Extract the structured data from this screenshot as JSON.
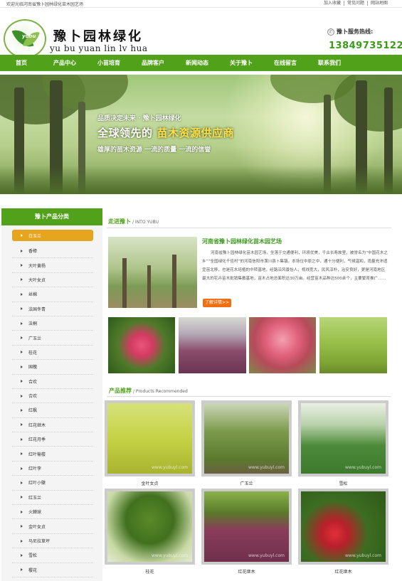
{
  "topbar": {
    "welcome": "欢迎光临河南省豫卜园林绿化苗木园艺场",
    "links": [
      "加入收藏",
      "常见问题",
      "网站地图"
    ]
  },
  "header": {
    "logo_badge": "yubu",
    "title": "豫卜园林绿化",
    "pinyin": "yu bu yuan lin lv hua",
    "hotline_label": "豫卜服务热线:",
    "phone": "13849735122"
  },
  "nav": [
    "首页",
    "产品中心",
    "小苗培育",
    "品牌客户",
    "新闻动态",
    "关于豫卜",
    "在线留言",
    "联系我们"
  ],
  "banner": {
    "line1": "品质决定未来 · 豫卜园林绿化",
    "line2_a": "全球领先的",
    "line2_b": "苗木资源供应商",
    "line3": "雄厚的苗木资源 一流的质量 一流的信誉"
  },
  "sidebar": {
    "title": "豫卜产品分类",
    "items": [
      "白玉兰",
      "香樟",
      "大叶黄杨",
      "大叶女贞",
      "丝棉",
      "法国冬青",
      "法桐",
      "广玉兰",
      "桂花",
      "国槐",
      "合欢",
      "合欢",
      "红枫",
      "红花继木",
      "红花月季",
      "红叶榆楼",
      "红叶李",
      "红叶小檗",
      "红玉兰",
      "火棘球",
      "金叶女贞",
      "马尼拉草坪",
      "雪松",
      "樱花"
    ]
  },
  "about": {
    "section_title": "走进豫卜",
    "section_sub": "/ INTO YUBU",
    "company": "河南省豫卜园林绿化苗木园艺场",
    "text": "河南省豫卜园林绿化苗木园艺场，坐落于交通便利，环境优美，千古长寿故里，被誉名为“中国花木之乡”“全国绿化千佳村”的河南信阳市潢川县卜集镇。本场位中原之中，通十分便利，气候温和，雨量充沛适宜苗北移，也是花木培植的中转基地，经路沿风景怡人，视线宽大，民风淳朴，治安良好，更是河南地区最大的花卉苗木批销集散基地，苗木占地总面积达30万亩。经营苗木品种达500余个，主要繁育推广……",
    "more": "了解详情>>"
  },
  "products": {
    "section_title": "产品推荐",
    "section_sub": "/ Products Recommended",
    "watermark": "www.yubuyl.com",
    "items": [
      {
        "name": "金叶女贞"
      },
      {
        "name": "广玉兰"
      },
      {
        "name": "雪松"
      },
      {
        "name": "桂花"
      },
      {
        "name": "红花继木"
      },
      {
        "name": "红花继木"
      }
    ]
  }
}
